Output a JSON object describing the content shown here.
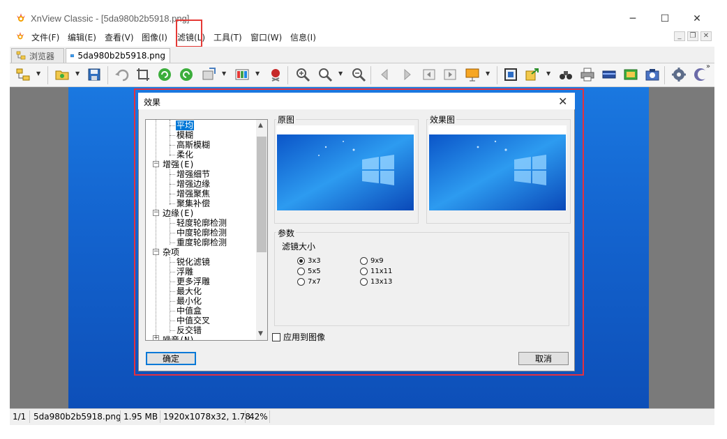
{
  "window": {
    "title": "XnView Classic - [5da980b2b5918.png]",
    "minimize": "─",
    "maximize": "☐",
    "close": "✕"
  },
  "menu": [
    "文件(F)",
    "编辑(E)",
    "查看(V)",
    "图像(I)",
    "滤镜(L)",
    "工具(T)",
    "窗口(W)",
    "信息(I)"
  ],
  "tabs": {
    "browser": "浏览器",
    "image": "5da980b2b5918.png"
  },
  "status": {
    "index": "1/1",
    "filename": "5da980b2b5918.png",
    "filesize": "1.95 MB",
    "dimensions": "1920x1078x32, 1.78",
    "zoom": "42%"
  },
  "dialog": {
    "title": "效果",
    "tree": {
      "selected": "平均",
      "items": [
        "平均",
        "模糊",
        "高斯模糊",
        "柔化",
        "增强(E)",
        "增强细节",
        "增强边缘",
        "增强聚焦",
        "聚集补偿",
        "边缘(E)",
        "轻度轮廓检测",
        "中度轮廓检测",
        "重度轮廓检测",
        "杂项",
        "锐化滤镜",
        "浮雕",
        "更多浮雕",
        "最大化",
        "最小化",
        "中值盒",
        "中值交叉",
        "反交错",
        "噪音(N)"
      ]
    },
    "original_label": "原图",
    "effect_label": "效果图",
    "params_label": "参数",
    "filter_size_label": "滤镜大小",
    "options": [
      {
        "label": "3x3",
        "checked": true
      },
      {
        "label": "5x5",
        "checked": false
      },
      {
        "label": "7x7",
        "checked": false
      },
      {
        "label": "9x9",
        "checked": false
      },
      {
        "label": "11x11",
        "checked": false
      },
      {
        "label": "13x13",
        "checked": false
      }
    ],
    "apply_label": "应用到图像",
    "ok_label": "确定",
    "cancel_label": "取消"
  }
}
